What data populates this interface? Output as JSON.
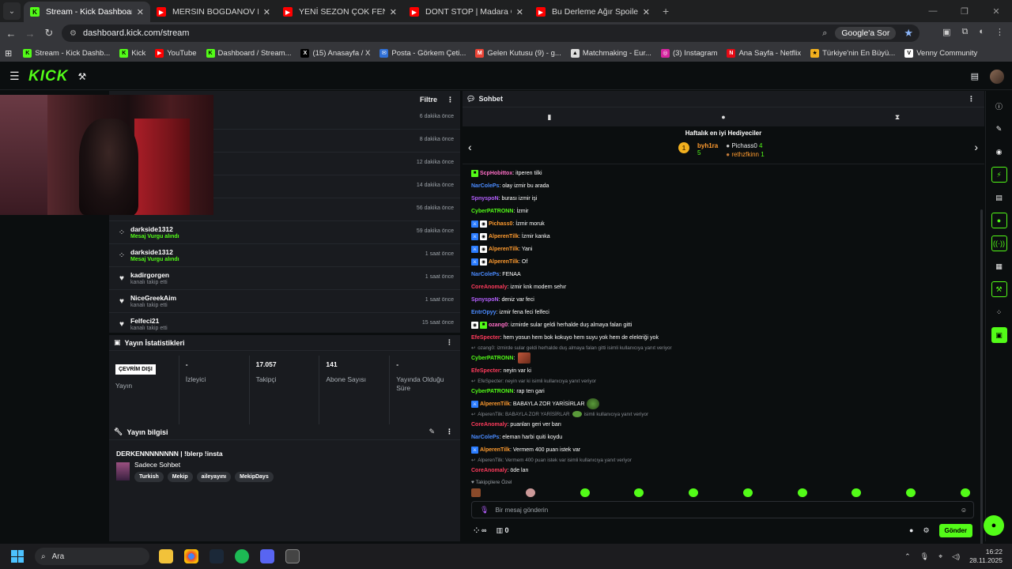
{
  "browser": {
    "tabs": [
      {
        "title": "Stream - Kick Dashboard",
        "active": true,
        "favicon": "kick"
      },
      {
        "title": "MERSIN BOGDANOV MEDIA TU",
        "active": false,
        "favicon": "youtube"
      },
      {
        "title": "YENİ SEZON ÇOK FENA BAŞLAD",
        "active": false,
        "favicon": "youtube"
      },
      {
        "title": "DONT STOP | Madara Olduk #6",
        "active": false,
        "favicon": "youtube"
      },
      {
        "title": "Bu Derleme Ağır Spoiler İçerirlt",
        "active": false,
        "favicon": "youtube"
      }
    ],
    "url": "dashboard.kick.com/stream",
    "google_label": "Google'a Sor",
    "bookmarks": [
      "Stream - Kick Dashb...",
      "Kick",
      "YouTube",
      "Dashboard / Stream...",
      "(15) Anasayfa / X",
      "Posta - Görkem Çeti...",
      "Gelen Kutusu (9) - g...",
      "Matchmaking - Eur...",
      "(3) Instagram",
      "Ana Sayfa - Netflix",
      "Türkiye'nin En Büyü...",
      "Venny Community"
    ]
  },
  "kick": {
    "logo": "KICK",
    "activity": {
      "filter_label": "Filtre",
      "items": [
        {
          "name": "",
          "sub": "",
          "time": "6 dakika önce",
          "icon": "gift-icon"
        },
        {
          "name": "",
          "sub": "",
          "time": "8 dakika önce",
          "icon": "gift-icon"
        },
        {
          "name": "",
          "sub": "",
          "time": "12 dakika önce",
          "icon": "gift-icon"
        },
        {
          "name": "",
          "sub": "",
          "time": "14 dakika önce",
          "icon": "gift-icon"
        },
        {
          "name": "",
          "sub": "Mesaj Vurgu alındı",
          "time": "56 dakika önce",
          "icon": "gift-icon"
        },
        {
          "name": "darkside1312",
          "sub": "Mesaj Vurgu alındı",
          "time": "59 dakika önce",
          "icon": "highlight-icon"
        },
        {
          "name": "darkside1312",
          "sub": "Mesaj Vurgu alındı",
          "time": "1 saat önce",
          "icon": "highlight-icon"
        },
        {
          "name": "kadirgorgen",
          "sub": "kanalı takip etti",
          "time": "1 saat önce",
          "icon": "heart-icon"
        },
        {
          "name": "NiceGreekAim",
          "sub": "kanalı takip etti",
          "time": "1 saat önce",
          "icon": "heart-icon"
        },
        {
          "name": "Felfeci21",
          "sub": "kanalı takip etti",
          "time": "15 saat önce",
          "icon": "heart-icon"
        }
      ]
    },
    "stats": {
      "title": "Yayın İstatistikleri",
      "status": "ÇEVRİM DIŞI",
      "cells": [
        {
          "value": "",
          "label": "Yayın"
        },
        {
          "value": "-",
          "label": "İzleyici"
        },
        {
          "value": "17.057",
          "label": "Takipçi"
        },
        {
          "value": "141",
          "label": "Abone Sayısı"
        },
        {
          "value": "-",
          "label": "Yayında Olduğu Süre"
        }
      ]
    },
    "stream_info": {
      "title": "Yayın bilgisi",
      "stream_title": "DERKENNNNNNNN | !blerp !insta",
      "category": "Sadece Sohbet",
      "tags": [
        "Turkish",
        "Mekip",
        "aileyayını",
        "MekipDays"
      ]
    },
    "chat": {
      "title": "Sohbet",
      "gifters_title": "Haftalık en iyi Hediyeciler",
      "gifters": [
        {
          "rank": "1",
          "name": "byh1ra",
          "count": "5"
        },
        {
          "name": "Pichass0",
          "count": "4"
        },
        {
          "name": "rethzfkinn",
          "count": "1"
        }
      ],
      "messages": [
        {
          "user": "ScpHobittox",
          "color": "#ff6ec7",
          "text": "itperen tilki",
          "badges": [
            "sub"
          ]
        },
        {
          "user": "NarColePs",
          "color": "#4a8bff",
          "text": "olay izmir bu arada"
        },
        {
          "user": "SpnyspoN",
          "color": "#b560ff",
          "text": "burası izmir işi"
        },
        {
          "user": "CyberPATRONN",
          "color": "#53fc18",
          "text": "İzmir"
        },
        {
          "user": "Pichass0",
          "color": "#ff9b2f",
          "text": "İzmir moruk",
          "badges": [
            "mod",
            "gift"
          ]
        },
        {
          "user": "AlperenTilk",
          "color": "#ff9b2f",
          "text": "İzmir kanka",
          "badges": [
            "mod",
            "gift"
          ]
        },
        {
          "user": "AlperenTilk",
          "color": "#ff9b2f",
          "text": "Yani",
          "badges": [
            "mod",
            "gift"
          ]
        },
        {
          "user": "AlperenTilk",
          "color": "#ff9b2f",
          "text": "Of",
          "badges": [
            "mod",
            "gift"
          ]
        },
        {
          "user": "NarColePs",
          "color": "#4a8bff",
          "text": "FENAA"
        },
        {
          "user": "CoreAnomaly",
          "color": "#ff3b5c",
          "text": "izmir knk modern sehır"
        },
        {
          "user": "SpnyspoN",
          "color": "#b560ff",
          "text": "deniz var feci"
        },
        {
          "user": "EntrOpyy",
          "color": "#4a8bff",
          "text": "izmir fena feci felfeci"
        },
        {
          "user": "ozang0",
          "color": "#ff6ec7",
          "text": "izmirde sular geldi herhalde duş almaya falan gitti",
          "badges": [
            "gift",
            "sub"
          ]
        },
        {
          "user": "EfeSpecter",
          "color": "#ff3b5c",
          "text": "hem yosun hem bok kokuyo hem suyu yok hem de elektriği yok"
        }
      ],
      "reply1": "ozang0: izmirde sular geldi herhalde duş almaya falan gitti isimli kullanıcıya yanıt veriyor",
      "msg_cyber1": {
        "user": "CyberPATRONN",
        "text": ""
      },
      "msg_efe": {
        "user": "EfeSpecter",
        "text": "neyin var ki"
      },
      "reply2": "EfeSpecter: neyin var ki isimli kullanıcıya yanıt veriyor",
      "msg_cyber2": {
        "user": "CyberPATRONN",
        "text": "rap ten gari"
      },
      "msg_alp1": {
        "user": "AlperenTilk",
        "text": "BABAYLA ZOR YARİSİRLAR"
      },
      "reply3a": "AlperenTilk: BABAYLA ZOR YARİSİRLAR",
      "reply3b": "isimli kullanıcıya yanıt veriyor",
      "msg_core1": {
        "user": "CoreAnomaly",
        "text": "puanları geri ver barı"
      },
      "msg_narc": {
        "user": "NarColePs",
        "text": "eleman harbi quiti koydu"
      },
      "msg_alp2": {
        "user": "AlperenTilk",
        "text": "Vermem 400 puan istek var"
      },
      "reply4": "AlperenTilk: Vermem 400 puan istek var isimli kullanıcıya yanıt veriyor",
      "msg_core2": {
        "user": "CoreAnomaly",
        "text": "öde lan"
      },
      "sub_label": "Takipçilere Özel",
      "input_placeholder": "Bir mesaj gönderin",
      "footer_count": "0",
      "send_label": "Gönder"
    }
  },
  "taskbar": {
    "search_placeholder": "Ara",
    "time": "16:22",
    "date": "28.11.2025"
  },
  "colors": {
    "accent": "#53fc18",
    "bg": "#0b0e0f",
    "panel": "#191b1f"
  }
}
